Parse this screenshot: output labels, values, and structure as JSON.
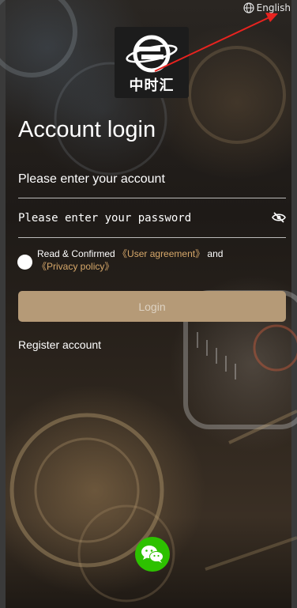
{
  "language": {
    "label": "English",
    "icon": "globe-icon"
  },
  "logo": {
    "text": "中时汇",
    "icon": "planet-ring-logo"
  },
  "login": {
    "title": "Account login",
    "account_placeholder": "Please enter your account",
    "password_placeholder": "Please enter your password",
    "agree_prefix": "Read & Confirmed ",
    "user_agreement": "《User agreement》",
    "agree_and": " and",
    "privacy_policy": "《Privacy policy》",
    "login_button": "Login",
    "register_link": "Register account"
  },
  "social": {
    "icon": "wechat-icon"
  },
  "colors": {
    "accent_gold": "#d7a86a",
    "button": "#b59a77",
    "wechat_green": "#2dc100",
    "annotation_arrow": "#e8231f"
  }
}
